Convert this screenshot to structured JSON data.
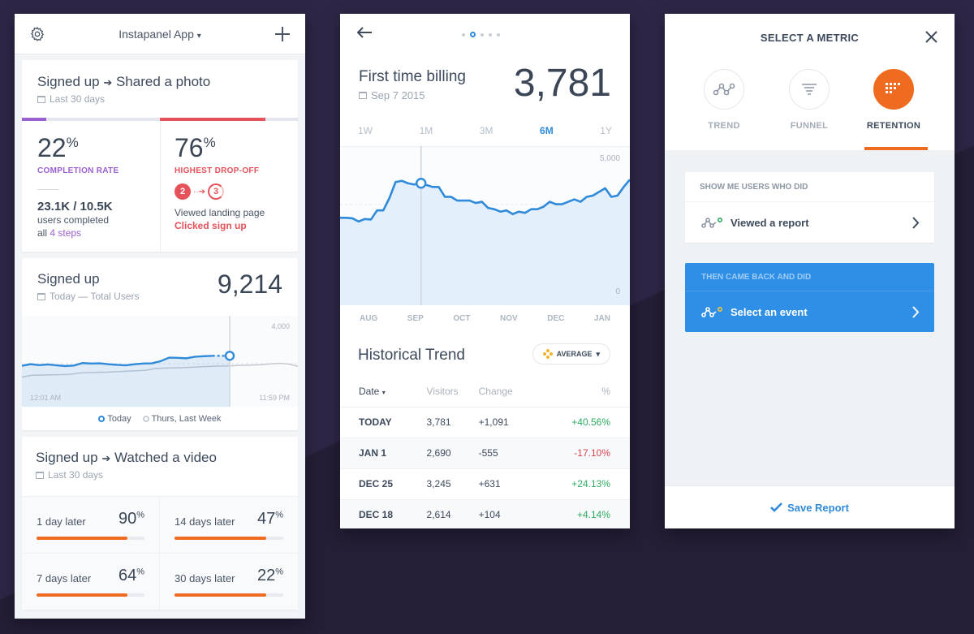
{
  "panel1": {
    "header": {
      "title": "Instapanel App",
      "caret": "▾"
    },
    "funnel": {
      "title": "Signed up",
      "title_to": "Shared a photo",
      "subtitle": "Last 30 days",
      "completion": {
        "value": "22",
        "unit": "%",
        "label": "COMPLETION RATE",
        "counts": "23.1K / 10.5K",
        "line1": "users completed",
        "line2_prefix": "all",
        "line2_link": "4 steps"
      },
      "dropoff": {
        "value": "76",
        "unit": "%",
        "label": "HIGHEST DROP-OFF",
        "step_from": "2",
        "step_to": "3",
        "from_event": "Viewed landing page",
        "to_event": "Clicked sign up"
      },
      "colors": {
        "completion": "#9b5fcf",
        "dropoff": "#e5525a"
      }
    },
    "signups": {
      "title": "Signed up",
      "subtitle": "Today — Total Users",
      "total": "9,214",
      "ymax_label": "4,000",
      "x_start": "12:01 AM",
      "x_end": "11:59 PM",
      "legend": [
        {
          "label": "Today"
        },
        {
          "label": "Thurs, Last Week"
        }
      ],
      "today": [
        1800,
        1870,
        1830,
        1860,
        1820,
        1790,
        1810,
        1920,
        1900,
        1910,
        1870,
        1840,
        1820,
        1870,
        1900,
        1910,
        2000,
        2160,
        2150,
        2130,
        2200,
        2220,
        2240
      ],
      "last_week": [
        1300,
        1380,
        1390,
        1400,
        1410,
        1420,
        1480,
        1500,
        1510,
        1520,
        1540,
        1560,
        1580,
        1600,
        1680,
        1700,
        1710,
        1720,
        1740,
        1760,
        1780,
        1790,
        1800,
        1820,
        1830,
        1840,
        1880,
        1910,
        1880,
        1780
      ]
    },
    "retention": {
      "title": "Signed up",
      "title_to": "Watched a video",
      "subtitle": "Last 30 days",
      "items": [
        {
          "label": "1 day later",
          "value": "90",
          "unit": "%",
          "fill": 0.84
        },
        {
          "label": "14 days later",
          "value": "47",
          "unit": "%",
          "fill": 0.84
        },
        {
          "label": "7 days later",
          "value": "64",
          "unit": "%",
          "fill": 0.84
        },
        {
          "label": "30 days later",
          "value": "22",
          "unit": "%",
          "fill": 0.84
        }
      ]
    }
  },
  "panel2": {
    "page_dots": {
      "count": 5,
      "active": 2
    },
    "title": "First time billing",
    "date": "Sep 7 2015",
    "value": "3,781",
    "ranges": [
      "1W",
      "1M",
      "3M",
      "6M",
      "1Y"
    ],
    "active_range": "6M",
    "chart": {
      "ymax_label": "5,000",
      "ymin_label": "0",
      "months": [
        "AUG",
        "SEP",
        "OCT",
        "NOV",
        "DEC",
        "JAN"
      ],
      "values": [
        2950,
        2950,
        2930,
        2800,
        2900,
        2880,
        3250,
        3250,
        3750,
        4400,
        4450,
        4350,
        4300,
        4350,
        4280,
        4200,
        4200,
        3800,
        3800,
        3650,
        3650,
        3650,
        3550,
        3600,
        3350,
        3300,
        3200,
        3250,
        3100,
        3200,
        3150,
        3300,
        3300,
        3400,
        3600,
        3500,
        3500,
        3600,
        3700,
        3600,
        3800,
        3850,
        4000,
        4150,
        3800,
        3850,
        4200,
        4500
      ],
      "marker_index": 13
    },
    "historical": {
      "title": "Historical Trend",
      "dropdown": "AVERAGE",
      "columns": [
        "Date",
        "Visitors",
        "Change",
        "%"
      ],
      "rows": [
        {
          "date": "TODAY",
          "visitors": "3,781",
          "change": "+1,091",
          "pct": "+40.56%",
          "dir": "up"
        },
        {
          "date": "JAN 1",
          "visitors": "2,690",
          "change": "-555",
          "pct": "-17.10%",
          "dir": "down"
        },
        {
          "date": "DEC 25",
          "visitors": "3,245",
          "change": "+631",
          "pct": "+24.13%",
          "dir": "up"
        },
        {
          "date": "DEC 18",
          "visitors": "2,614",
          "change": "+104",
          "pct": "+4.14%",
          "dir": "up"
        }
      ],
      "colors": {
        "up": "#2eaa62",
        "down": "#d9434e"
      }
    }
  },
  "panel3": {
    "title": "SELECT A METRIC",
    "metrics": [
      {
        "label": "TREND"
      },
      {
        "label": "FUNNEL"
      },
      {
        "label": "RETENTION",
        "active": true
      }
    ],
    "accent": "#ef6b1f",
    "first_section": {
      "header": "SHOW ME USERS WHO DID",
      "event": "Viewed a report"
    },
    "second_section": {
      "header": "THEN CAME BACK AND DID",
      "event": "Select an event"
    },
    "save": "Save Report"
  }
}
